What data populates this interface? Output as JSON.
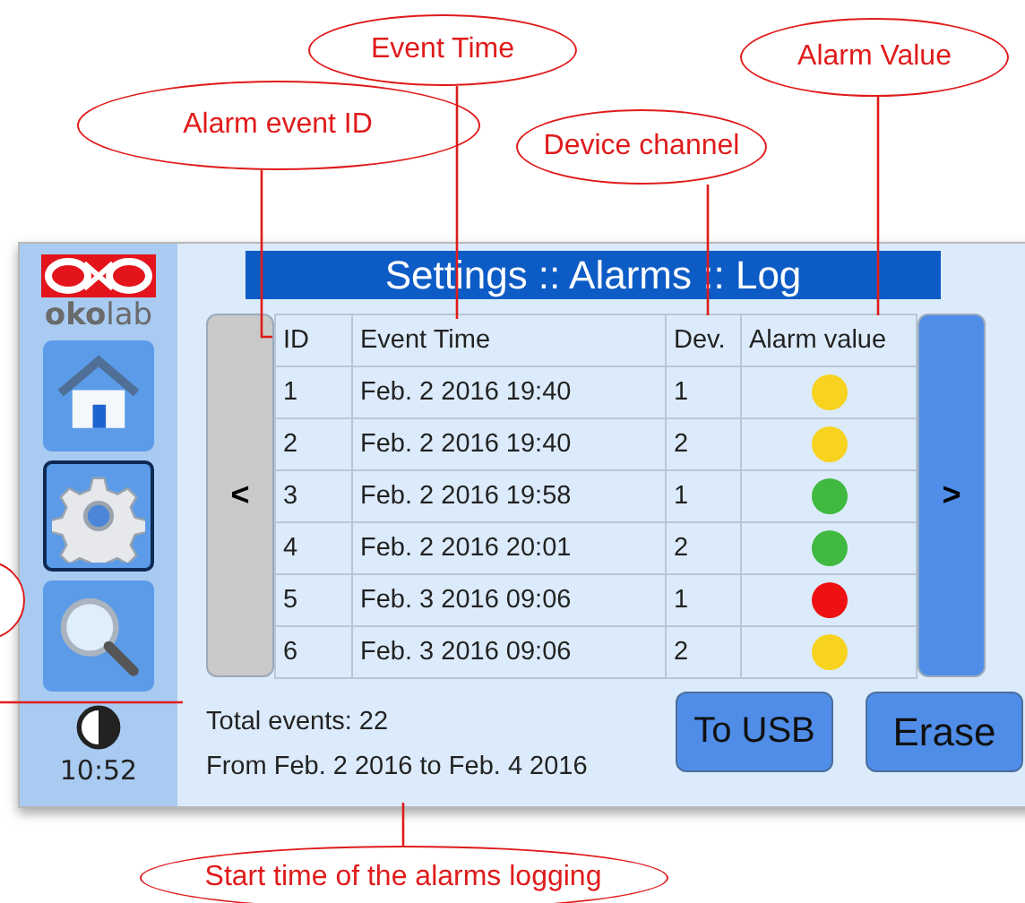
{
  "annotations": [
    {
      "kind": "callout",
      "label": "Event Time"
    },
    {
      "kind": "callout",
      "label": "Alarm Value"
    },
    {
      "kind": "callout",
      "label": "Alarm event ID"
    },
    {
      "kind": "callout",
      "label": "Device channel"
    },
    {
      "kind": "callout",
      "label": "Start time of the alarms logging"
    },
    {
      "kind": "cut-callout"
    }
  ],
  "screen": {
    "logo": {
      "text": "**oko**lab"
    },
    "nav": [
      {
        "kind": "home",
        "selected": false
      },
      {
        "kind": "settings",
        "selected": true
      },
      {
        "kind": "search",
        "selected": false
      }
    ],
    "clock": "10:52",
    "title": "Settings :: Alarms :: Log",
    "prev_button": "<",
    "next_button": ">",
    "table": {
      "columns": [
        "ID",
        "Event Time",
        "Dev.",
        "Alarm value"
      ],
      "rows": [
        {
          "id": "1",
          "time": "Feb. 2 2016 19:40",
          "dev": "1",
          "color": "#f7d21e"
        },
        {
          "id": "2",
          "time": "Feb. 2 2016 19:40",
          "dev": "2",
          "color": "#f7d21e"
        },
        {
          "id": "3",
          "time": "Feb. 2 2016 19:58",
          "dev": "1",
          "color": "#3fb93f"
        },
        {
          "id": "4",
          "time": "Feb. 2 2016 20:01",
          "dev": "2",
          "color": "#3fb93f"
        },
        {
          "id": "5",
          "time": "Feb. 3 2016 09:06",
          "dev": "1",
          "color": "#ee1111"
        },
        {
          "id": "6",
          "time": "Feb. 3 2016 09:06",
          "dev": "2",
          "color": "#f7d21e"
        }
      ]
    },
    "total_events": "Total events: 22",
    "range": "From Feb. 2 2016  to Feb. 4 2016",
    "buttons": [
      "To USB",
      "Erase"
    ]
  }
}
